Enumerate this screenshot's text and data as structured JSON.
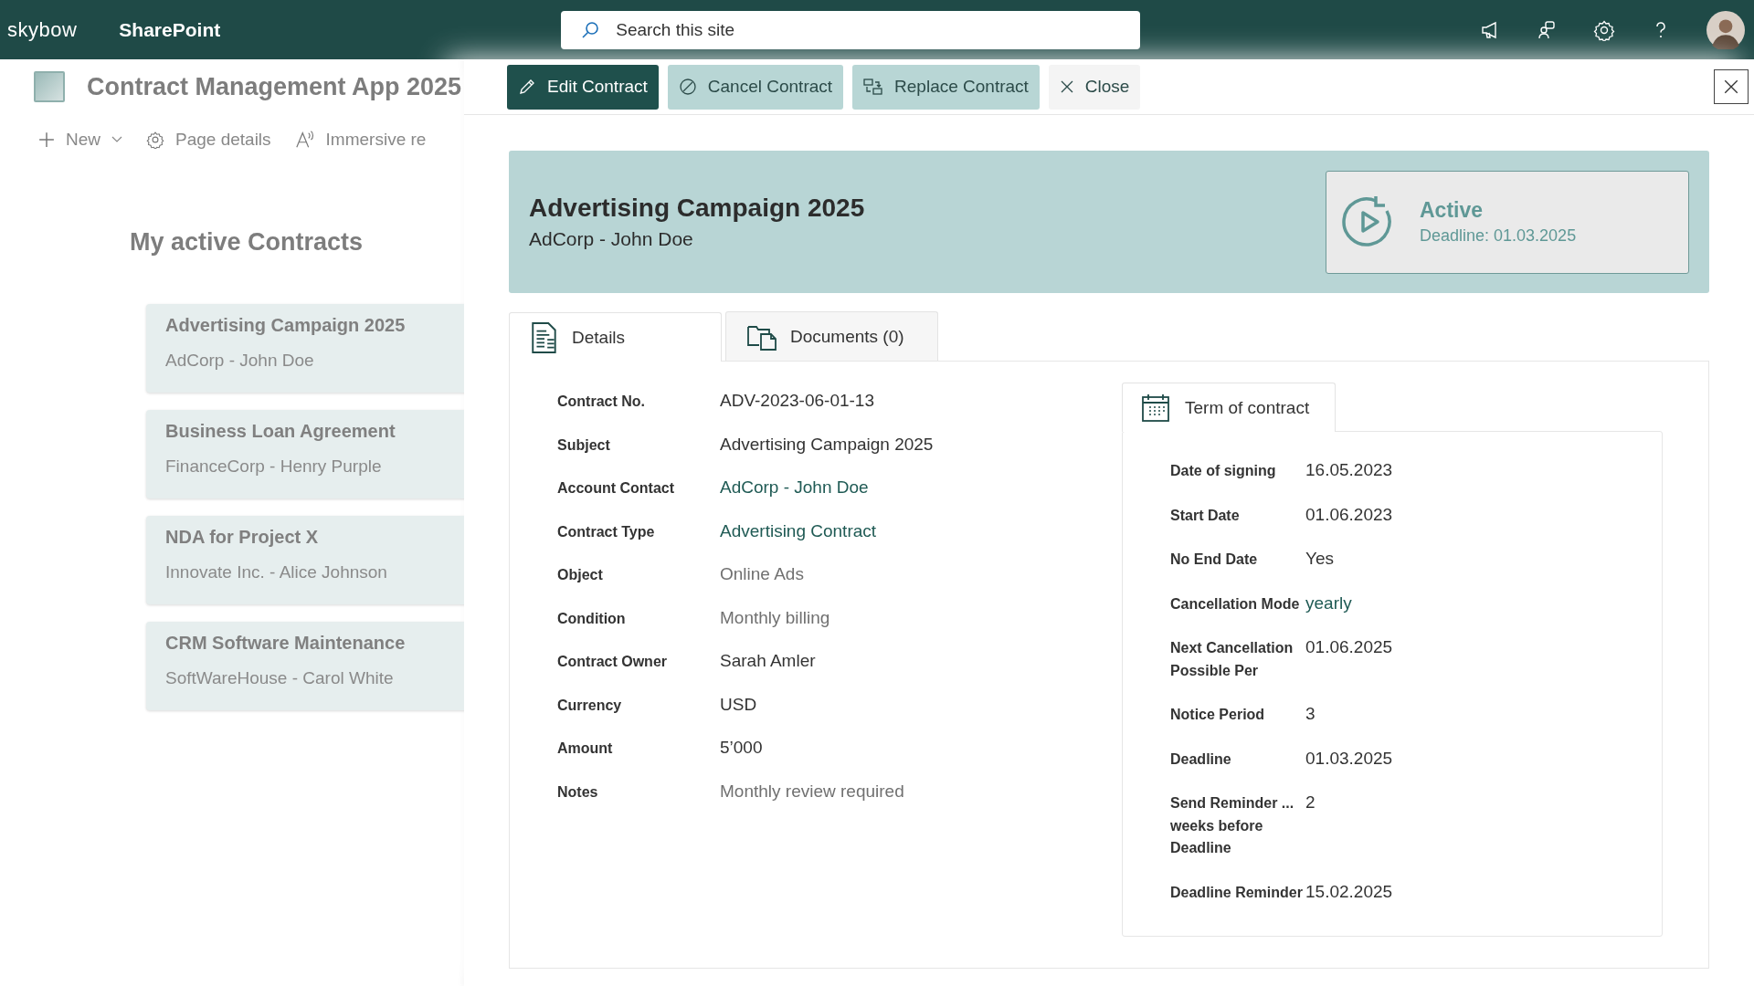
{
  "topbar": {
    "logo": "skybow",
    "app": "SharePoint",
    "search": {
      "placeholder": "Search this site"
    }
  },
  "site": {
    "title": "Contract Management App 2025",
    "commands": [
      {
        "kind": "new",
        "label": "New"
      },
      {
        "kind": "details",
        "label": "Page details"
      },
      {
        "kind": "reader",
        "label": "Immersive re"
      }
    ],
    "section_title": "My active Contracts",
    "cards": [
      {
        "title": "Advertising Campaign 2025",
        "subtitle": "AdCorp - John Doe"
      },
      {
        "title": "Business Loan Agreement",
        "subtitle": "FinanceCorp - Henry Purple"
      },
      {
        "title": "NDA for Project X",
        "subtitle": "Innovate Inc. - Alice Johnson"
      },
      {
        "title": "CRM Software Maintenance",
        "subtitle": "SoftWareHouse - Carol White"
      }
    ]
  },
  "panel": {
    "buttons": [
      {
        "kind": "edit",
        "label": "Edit Contract"
      },
      {
        "kind": "cancel",
        "label": "Cancel Contract"
      },
      {
        "kind": "replace",
        "label": "Replace Contract"
      },
      {
        "kind": "close",
        "label": "Close"
      }
    ],
    "banner": {
      "title": "Advertising Campaign 2025",
      "subtitle": "AdCorp - John Doe",
      "status": "Active",
      "deadline": "Deadline: 01.03.2025"
    },
    "tabs": [
      {
        "kind": "details",
        "label": "Details",
        "selected": true
      },
      {
        "kind": "documents",
        "label": "Documents (0)",
        "selected": false
      }
    ],
    "fields": [
      {
        "label": "Contract No.",
        "value": "ADV-2023-06-01-13",
        "kind": "text"
      },
      {
        "label": "Subject",
        "value": "Advertising Campaign 2025",
        "kind": "text"
      },
      {
        "label": "Account Contact",
        "value": "AdCorp - John Doe",
        "kind": "link"
      },
      {
        "label": "Contract Type",
        "value": "Advertising Contract",
        "kind": "link"
      },
      {
        "label": "Object",
        "value": "Online Ads",
        "kind": "muted"
      },
      {
        "label": "Condition",
        "value": "Monthly billing",
        "kind": "muted"
      },
      {
        "label": "Contract Owner",
        "value": "Sarah Amler",
        "kind": "text"
      },
      {
        "label": "Currency",
        "value": "USD",
        "kind": "text"
      },
      {
        "label": "Amount",
        "value": "5’000",
        "kind": "text"
      },
      {
        "label": "Notes",
        "value": "Monthly review required",
        "kind": "muted"
      }
    ],
    "term": {
      "tab": "Term of contract",
      "fields": [
        {
          "label": "Date of signing",
          "value": "16.05.2023",
          "kind": "text"
        },
        {
          "label": "Start Date",
          "value": "01.06.2023",
          "kind": "text"
        },
        {
          "label": "No End Date",
          "value": "Yes",
          "kind": "text"
        },
        {
          "label": "Cancellation Mode",
          "value": "yearly",
          "kind": "link"
        },
        {
          "label": "Next Cancellation Possible Per",
          "value": "01.06.2025",
          "kind": "text"
        },
        {
          "label": "Notice Period",
          "value": "3",
          "kind": "text"
        },
        {
          "label": "Deadline",
          "value": "01.03.2025",
          "kind": "text"
        },
        {
          "label": "Send Reminder ... weeks before Deadline",
          "value": "2",
          "kind": "text"
        },
        {
          "label": "Deadline Reminder",
          "value": "15.02.2025",
          "kind": "text"
        }
      ]
    }
  }
}
